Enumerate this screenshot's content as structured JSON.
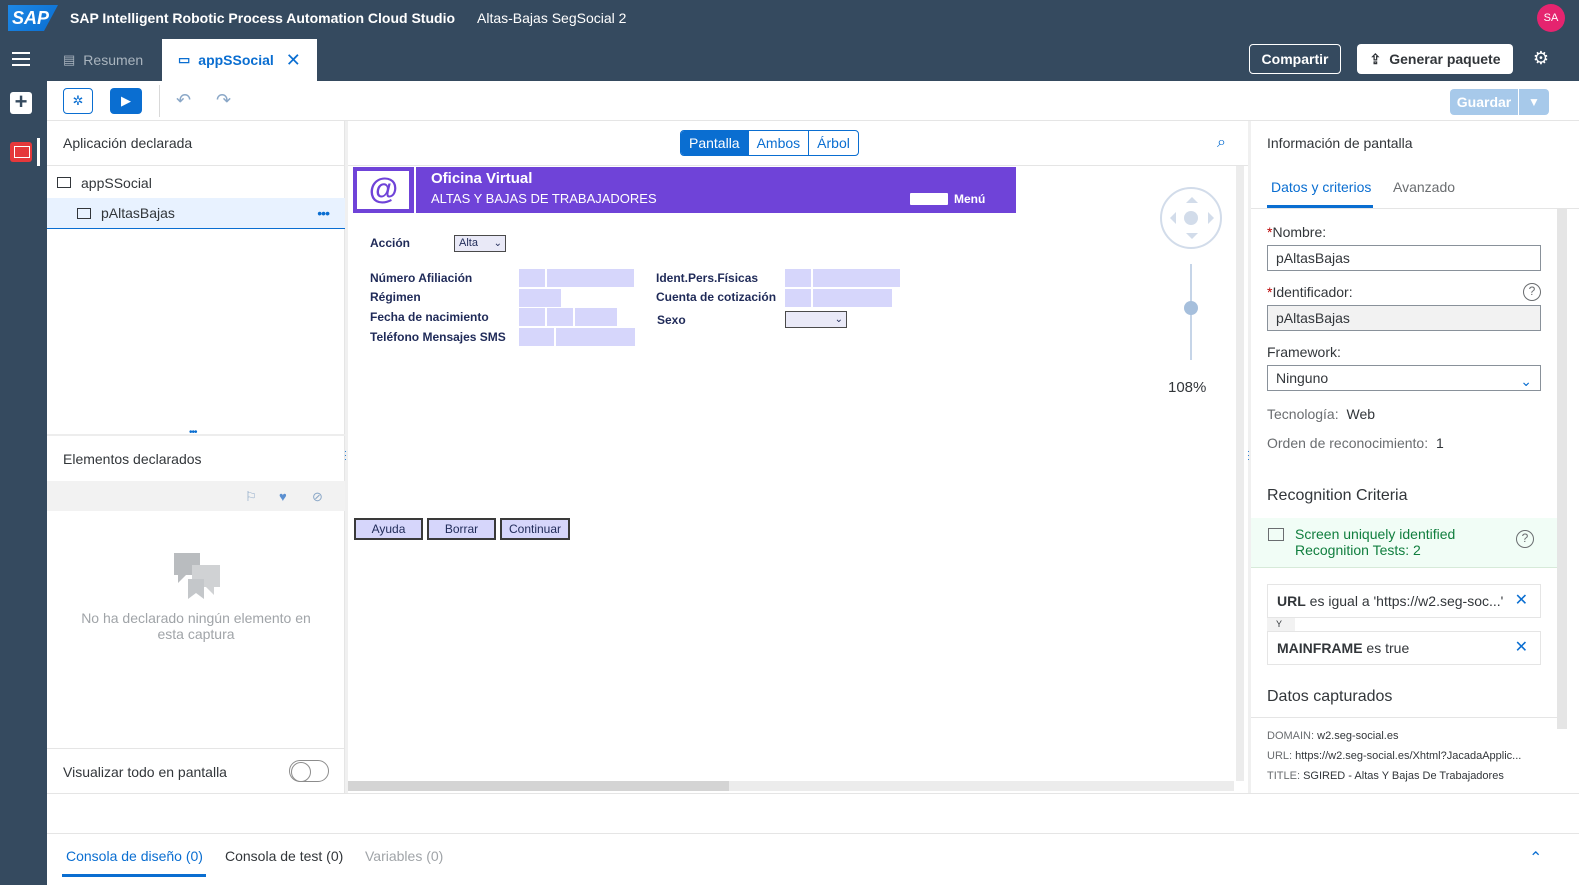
{
  "shell": {
    "logo": "SAP",
    "app_title": "SAP Intelligent Robotic Process Automation Cloud Studio",
    "project_title": "Altas-Bajas SegSocial 2",
    "avatar": "SA"
  },
  "tabs": [
    {
      "label": "Resumen",
      "icon": "document-icon",
      "active": false
    },
    {
      "label": "appSSocial",
      "icon": "monitor-icon",
      "active": true
    }
  ],
  "header_actions": {
    "share": "Compartir",
    "generate_package": "Generar paquete",
    "settings_icon": "gear-icon"
  },
  "toolbar": {
    "save": "Guardar"
  },
  "left_panel": {
    "declared_app_title": "Aplicación declarada",
    "tree": [
      {
        "label": "appSSocial",
        "level": 0
      },
      {
        "label": "pAltasBajas",
        "level": 1,
        "selected": true
      }
    ],
    "declared_elements_title": "Elementos declarados",
    "empty_text": "No ha declarado ningún elemento en esta captura",
    "show_all_label": "Visualizar todo en pantalla",
    "show_all_enabled": false
  },
  "center": {
    "view_modes": [
      "Pantalla",
      "Ambos",
      "Árbol"
    ],
    "active_view": "Pantalla",
    "zoom": "108%",
    "capture": {
      "logo_text": "@",
      "title": "Oficina Virtual",
      "subtitle": "ALTAS Y BAJAS DE TRABAJADORES",
      "menu": "Menú",
      "accion_label": "Acción",
      "accion_value": "Alta",
      "fields_left": [
        "Número Afiliación",
        "Régimen",
        "Fecha de nacimiento",
        "Teléfono Mensajes SMS"
      ],
      "fields_right": [
        "Ident.Pers.Físicas",
        "Cuenta de cotización",
        "Sexo"
      ],
      "buttons": [
        "Ayuda",
        "Borrar",
        "Continuar"
      ]
    }
  },
  "right_panel": {
    "title": "Información de pantalla",
    "tabs": [
      "Datos y criterios",
      "Avanzado"
    ],
    "nombre_label": "Nombre:",
    "nombre_value": "pAltasBajas",
    "identificador_label": "Identificador:",
    "identificador_value": "pAltasBajas",
    "framework_label": "Framework:",
    "framework_value": "Ninguno",
    "tecnologia_label": "Tecnología:",
    "tecnologia_value": "Web",
    "orden_label": "Orden de reconocimiento:",
    "orden_value": "1",
    "recognition_title": "Recognition Criteria",
    "status_line1": "Screen uniquely identified",
    "status_line2": "Recognition Tests: 2",
    "criteria": [
      {
        "key": "URL",
        "text": " es igual a 'https://w2.seg-soc...'"
      },
      {
        "key": "MAINFRAME",
        "text": " es true"
      }
    ],
    "criteria_join": "Y",
    "captured_title": "Datos capturados",
    "captured": [
      {
        "key": "DOMAIN:",
        "value": "w2.seg-social.es"
      },
      {
        "key": "URL:",
        "value": "https://w2.seg-social.es/Xhtml?JacadaApplic..."
      },
      {
        "key": "TITLE:",
        "value": "SGIRED - Altas Y Bajas De Trabajadores"
      }
    ]
  },
  "console": {
    "tabs": [
      "Consola de diseño (0)",
      "Consola de test (0)",
      "Variables (0)"
    ]
  },
  "colors": {
    "shell": "#354a5f",
    "accent": "#0a6ed1",
    "banner": "#6f43d8",
    "avatar": "#e5246f",
    "success": "#107e3e"
  }
}
